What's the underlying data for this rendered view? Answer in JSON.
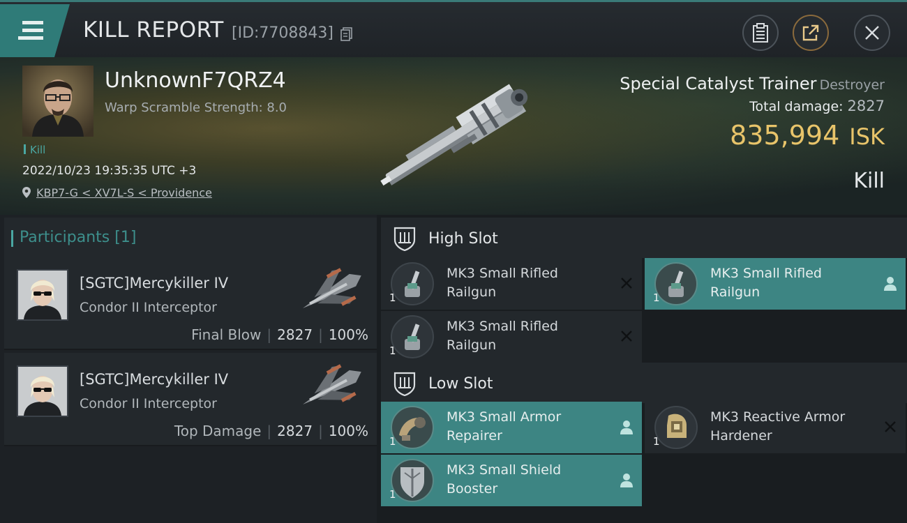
{
  "header": {
    "title": "KILL REPORT",
    "report_id": "[ID:7708843]",
    "icons": [
      "menu-icon",
      "copy-icon",
      "clipboard-icon",
      "share-icon",
      "close-icon"
    ]
  },
  "victim": {
    "name": "UnknownF7QRZ4",
    "warp_scramble": "Warp Scramble Strength: 8.0",
    "type_tag": "Kill",
    "datetime": "2022/10/23 19:35:35 UTC +3",
    "location": "KBP7-G < XV7L-S < Providence",
    "ship_name": "Special Catalyst Trainer",
    "ship_class": "Destroyer",
    "total_damage_label": "Total damage:",
    "total_damage_value": "2827",
    "isk_value": "835,994",
    "isk_unit": "ISK",
    "result": "Kill"
  },
  "participants": {
    "label": "Participants",
    "count": "[1]",
    "rows": [
      {
        "name": "[SGTC]Mercykiller IV",
        "ship": "Condor II Interceptor",
        "role": "Final Blow",
        "damage": "2827",
        "percent": "100%"
      },
      {
        "name": "[SGTC]Mercykiller IV",
        "ship": "Condor II Interceptor",
        "role": "Top Damage",
        "damage": "2827",
        "percent": "100%"
      }
    ]
  },
  "slots": {
    "high": {
      "label": "High Slot",
      "modules": [
        {
          "name": "MK3 Small Rifled Railgun",
          "qty": "1",
          "status": "destroyed"
        },
        {
          "name": "MK3 Small Rifled Railgun",
          "qty": "1",
          "status": "dropped"
        },
        {
          "name": "MK3 Small Rifled Railgun",
          "qty": "1",
          "status": "destroyed"
        }
      ]
    },
    "low": {
      "label": "Low Slot",
      "modules": [
        {
          "name": "MK3 Small Armor Repairer",
          "qty": "1",
          "status": "dropped"
        },
        {
          "name": "MK3 Reactive Armor Hardener",
          "qty": "1",
          "status": "destroyed"
        },
        {
          "name": "MK3 Small Shield Booster",
          "qty": "1",
          "status": "dropped"
        }
      ]
    }
  },
  "colors": {
    "accent": "#3d8583",
    "isk": "#e8c46a",
    "teal_text": "#4aa7a2"
  }
}
